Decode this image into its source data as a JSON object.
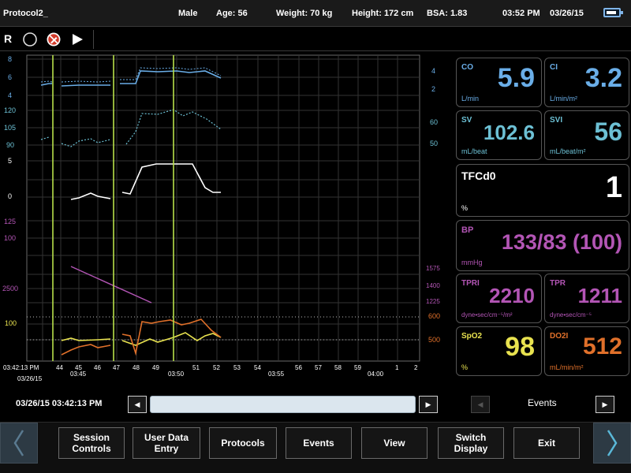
{
  "header": {
    "protocol": "Protocol2_",
    "sex": "Male",
    "age": "Age: 56",
    "weight": "Weight: 70 kg",
    "height": "Height: 172 cm",
    "bsa": "BSA: 1.83",
    "time": "03:52 PM",
    "date": "03/26/15"
  },
  "controls": {
    "r_label": "R",
    "icons": [
      "record-circle-icon",
      "no-pen-icon",
      "play-icon"
    ]
  },
  "colors": {
    "co": "#6aaee8",
    "sv": "#6cc0d4",
    "tfc": "#ffffff",
    "bp": "#b355b5",
    "spo2": "#e8e24f",
    "do2i": "#e0702a",
    "grid": "#3a3a3a",
    "marker": "#b8e04a"
  },
  "graph": {
    "left_axis": {
      "co": [
        "8",
        "6",
        "4"
      ],
      "sv": [
        "120",
        "105",
        "90"
      ],
      "tfc": [
        "5",
        "0"
      ],
      "bp": [
        "125",
        "100"
      ],
      "tpr": [
        "2500"
      ],
      "spo2": [
        "100"
      ]
    },
    "right_axis": {
      "ci": [
        "4",
        "2"
      ],
      "svi": [
        "60",
        "50"
      ],
      "tpri": [
        "1575",
        "1400",
        "1225"
      ],
      "do2i": [
        "600",
        "500"
      ]
    },
    "x_ticks": [
      "03:42:13 PM",
      "44",
      "45",
      "46",
      "47",
      "48",
      "49",
      "03:50",
      "51",
      "52",
      "53",
      "54",
      "03:55",
      "56",
      "57",
      "58",
      "59",
      "04:00",
      "1",
      "2"
    ],
    "x_start_date": "03/26/15",
    "x_sub": {
      "45": "03:45"
    }
  },
  "panels": {
    "co": {
      "label": "CO",
      "value": "5.9",
      "unit": "L/min"
    },
    "ci": {
      "label": "CI",
      "value": "3.2",
      "unit": "L/min/m²"
    },
    "sv": {
      "label": "SV",
      "value": "102.6",
      "unit": "mL/beat"
    },
    "svi": {
      "label": "SVI",
      "value": "56",
      "unit": "mL/beat/m²"
    },
    "tfc": {
      "label": "TFCd0",
      "value": "1",
      "unit": "%"
    },
    "bp": {
      "label": "BP",
      "value": "133/83 (100)",
      "unit": "mmHg"
    },
    "tpri": {
      "label": "TPRI",
      "value": "2210",
      "unit": "dyne•sec/cm⁻⁵/m²"
    },
    "tpr": {
      "label": "TPR",
      "value": "1211",
      "unit": "dyne•sec/cm⁻⁵"
    },
    "spo2": {
      "label": "SpO2",
      "value": "98",
      "unit": "%"
    },
    "do2i": {
      "label": "DO2I",
      "value": "512",
      "unit": "mL/min/m²"
    }
  },
  "timeline": {
    "timestamp": "03/26/15 03:42:13 PM",
    "events_label": "Events"
  },
  "nav": {
    "session_controls": "Session Controls",
    "user_data_entry": "User Data Entry",
    "protocols": "Protocols",
    "events": "Events",
    "view": "View",
    "switch_display": "Switch Display",
    "exit": "Exit"
  }
}
